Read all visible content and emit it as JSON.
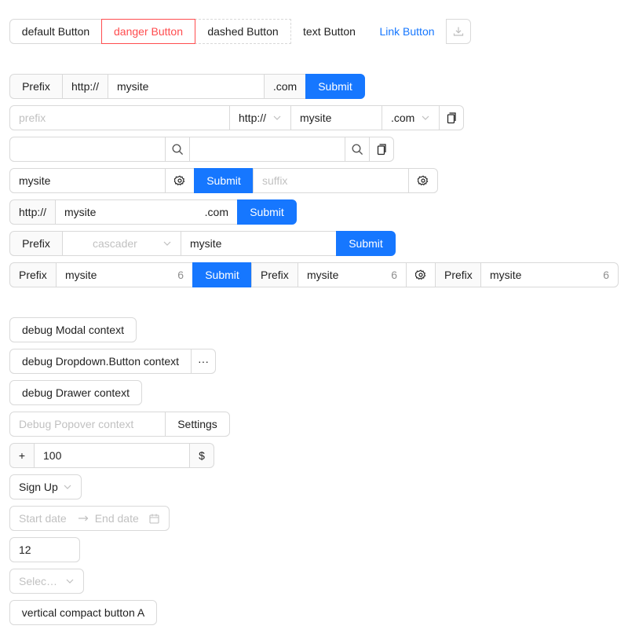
{
  "buttons_row": {
    "default_label": "default Button",
    "danger_label": "danger Button",
    "dashed_label": "dashed Button",
    "text_label": "text Button",
    "link_label": "Link Button",
    "download_icon": "download-icon"
  },
  "row1": {
    "prefix": "Prefix",
    "protocol": "http://",
    "value": "mysite",
    "suffix": ".com",
    "submit": "Submit"
  },
  "row2": {
    "prefix_placeholder": "prefix",
    "protocol": "http://",
    "value": "mysite",
    "suffix": ".com",
    "copy_icon": "copy-icon"
  },
  "row3": {
    "search_icon": "search-icon",
    "copy_icon": "copy-icon"
  },
  "row4": {
    "value": "mysite",
    "submit": "Submit",
    "suffix_placeholder": "suffix",
    "setting_icon": "setting-icon"
  },
  "row5": {
    "protocol": "http://",
    "value": "mysite",
    "suffix": ".com",
    "submit": "Submit"
  },
  "row6": {
    "prefix": "Prefix",
    "cascader_placeholder": "cascader",
    "value": "mysite",
    "submit": "Submit"
  },
  "row7": {
    "prefix": "Prefix",
    "value": "mysite",
    "count": "6",
    "submit": "Submit",
    "prefix2": "Prefix",
    "value2": "mysite",
    "count2": "6",
    "prefix3": "Prefix",
    "value3": "mysite",
    "count3": "6"
  },
  "debug": {
    "modal_label": "debug Modal context",
    "dropdown_label": "debug Dropdown.Button context",
    "dropdown_more": "···",
    "drawer_label": "debug Drawer context",
    "popover_placeholder": "Debug Popover context",
    "settings_label": "Settings"
  },
  "number_row": {
    "addon_before": "+",
    "value": "100",
    "addon_after": "$"
  },
  "signup_select": {
    "value": "Sign Up"
  },
  "date_range": {
    "start_placeholder": "Start date",
    "end_placeholder": "End date"
  },
  "number_input": {
    "value": "12"
  },
  "select_placeholder": {
    "text": "Selec…"
  },
  "vertical_button": {
    "label": "vertical compact button A"
  },
  "colors": {
    "primary": "#1677ff",
    "danger": "#ff4d4f",
    "border": "#d9d9d9"
  }
}
